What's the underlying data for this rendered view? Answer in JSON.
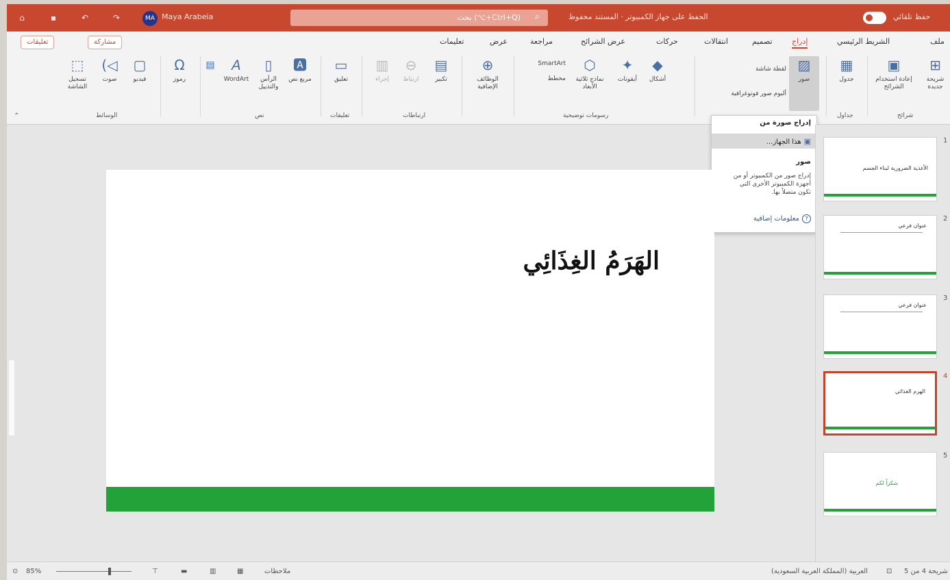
{
  "titlebar": {
    "username": "Maya Arabeia",
    "avatar_initials": "MA",
    "search_placeholder": "بحث (⌥+Ctrl+Q)",
    "document_title": "الحفظ على جهاز الكمبيوتر · المستند محفوظ",
    "autosave_label": "حفظ تلقائي",
    "icons": [
      "home-icon",
      "save-icon",
      "undo-icon",
      "redo-icon"
    ]
  },
  "ribbon": {
    "tabs": [
      "ملف",
      "الشريط الرئيسي",
      "إدراج",
      "تصميم",
      "انتقالات",
      "حركات",
      "عرض الشرائح",
      "مراجعة",
      "عرض",
      "تعليمات"
    ],
    "active_tab": "إدراج",
    "share_label": "مشاركة",
    "comments_label": "تعليقات",
    "groups": {
      "slides": {
        "label": "شرائح",
        "new_slide": "شريحة جديدة",
        "reuse": "إعادة استخدام الشرائح"
      },
      "tables": {
        "label": "جداول",
        "table": "جدول"
      },
      "images": {
        "label": "صور",
        "pictures": "صور",
        "screenshot": "لقطة شاشة",
        "photo_album": "ألبوم صور فوتوغرافية"
      },
      "illustrations": {
        "label": "رسومات توضيحية",
        "shapes": "أشكال",
        "icons": "أيقونات",
        "models3d": "نماذج ثلاثية الأبعاد",
        "smartart": "SmartArt",
        "chart": "مخطط"
      },
      "addins": {
        "label": "",
        "addins": "الوظائف الإضافية"
      },
      "links": {
        "label": "ارتباطات",
        "zoom": "تكبير",
        "link": "ارتباط",
        "action": "إجراء"
      },
      "comments": {
        "label": "تعليقات",
        "comment": "تعليق"
      },
      "text": {
        "label": "نص",
        "textbox": "مربع نص",
        "header_footer": "الرأس والتذييل",
        "wordart": "WordArt"
      },
      "symbols": {
        "label": "",
        "symbols": "رموز"
      },
      "media": {
        "label": "الوسائط",
        "video": "فيديو",
        "audio": "صوت",
        "screen_recording": "تسجيل الشاشة"
      }
    }
  },
  "dropdown": {
    "header": "إدراج صورة من",
    "item": "هذا الجهاز...",
    "tip_title": "صور",
    "tip_desc": "إدراج صور من الكمبيوتر أو من أجهزة الكمبيوتر الأخرى التي تكون متصلاً بها.",
    "more_info": "معلومات إضافية"
  },
  "slide": {
    "title": "الهَرَمُ الغِذَائِي",
    "bar_color": "#23a23a"
  },
  "thumbnails": [
    {
      "num": "1",
      "title": "الأغذية الضرورية لبناء الجسم"
    },
    {
      "num": "2",
      "title": "عنوان فرعي"
    },
    {
      "num": "3",
      "title": "عنوان فرعي"
    },
    {
      "num": "4",
      "title": "الهرم الغذائي"
    },
    {
      "num": "5",
      "title": "شكراً لكم"
    }
  ],
  "statusbar": {
    "slide_info": "شريحة 4 من 5",
    "language": "العربية (المملكة العربية السعودية)",
    "notes": "ملاحظات",
    "zoom": "85%"
  },
  "colors": {
    "accent": "#c8472f",
    "green": "#23a23a"
  }
}
